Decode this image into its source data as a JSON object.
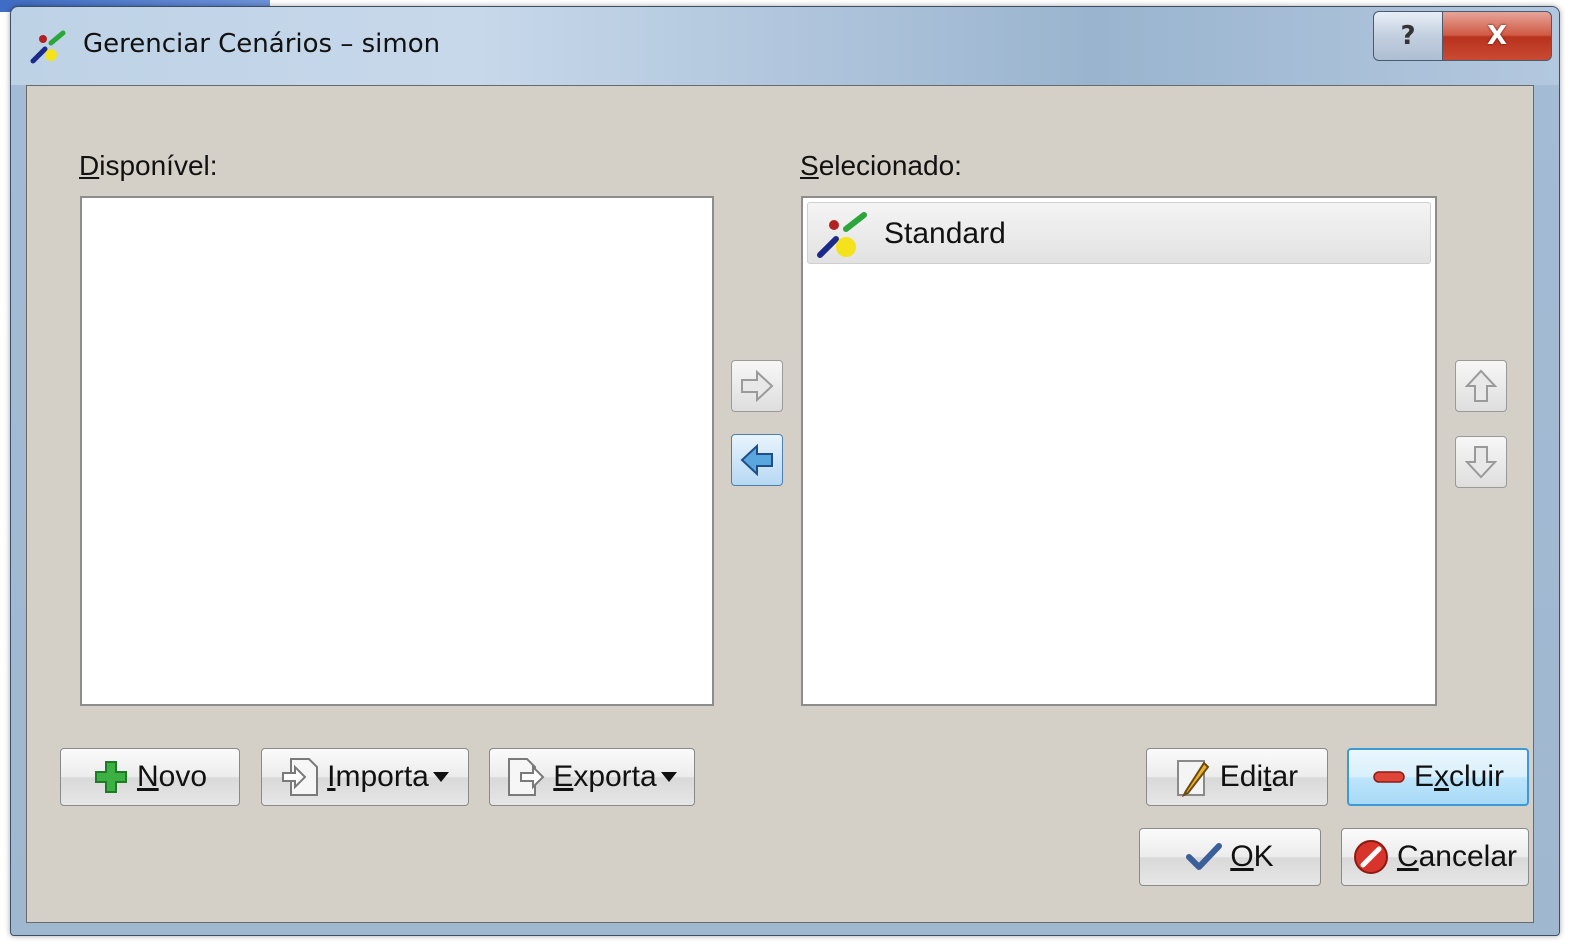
{
  "window": {
    "title": "Gerenciar Cenários – simon",
    "help_button": "?",
    "close_button": "X"
  },
  "available": {
    "label_accel": "D",
    "label_rest": "isponível:",
    "items": []
  },
  "selected": {
    "label_accel": "S",
    "label_rest": "elecionado:",
    "items": [
      {
        "label": "Standard",
        "icon": "scenario-icon"
      }
    ]
  },
  "transfer_buttons": {
    "add_icon": "arrow-right-icon",
    "remove_icon": "arrow-left-icon",
    "up_icon": "arrow-up-icon",
    "down_icon": "arrow-down-icon"
  },
  "buttons": {
    "novo": {
      "accel": "N",
      "rest": "ovo",
      "icon": "plus-icon"
    },
    "importar": {
      "accel": "I",
      "rest": "mporta",
      "icon": "import-icon"
    },
    "exportar": {
      "accel": "E",
      "rest": "xporta",
      "icon": "export-icon"
    },
    "editar": {
      "before": "Edi",
      "accel": "t",
      "after": "ar",
      "icon": "pencil-icon"
    },
    "excluir": {
      "before": "E",
      "accel": "x",
      "after": "cluir",
      "icon": "minus-icon"
    },
    "ok": {
      "accel": "O",
      "rest": "K",
      "icon": "check-icon"
    },
    "cancelar": {
      "accel": "C",
      "rest": "ancelar",
      "icon": "cancel-icon"
    }
  },
  "colors": {
    "client_bg": "#d4d0c8",
    "titlebar": "#b3c8de",
    "close_red": "#c94a33",
    "default_button_border": "#3c9ad8"
  }
}
